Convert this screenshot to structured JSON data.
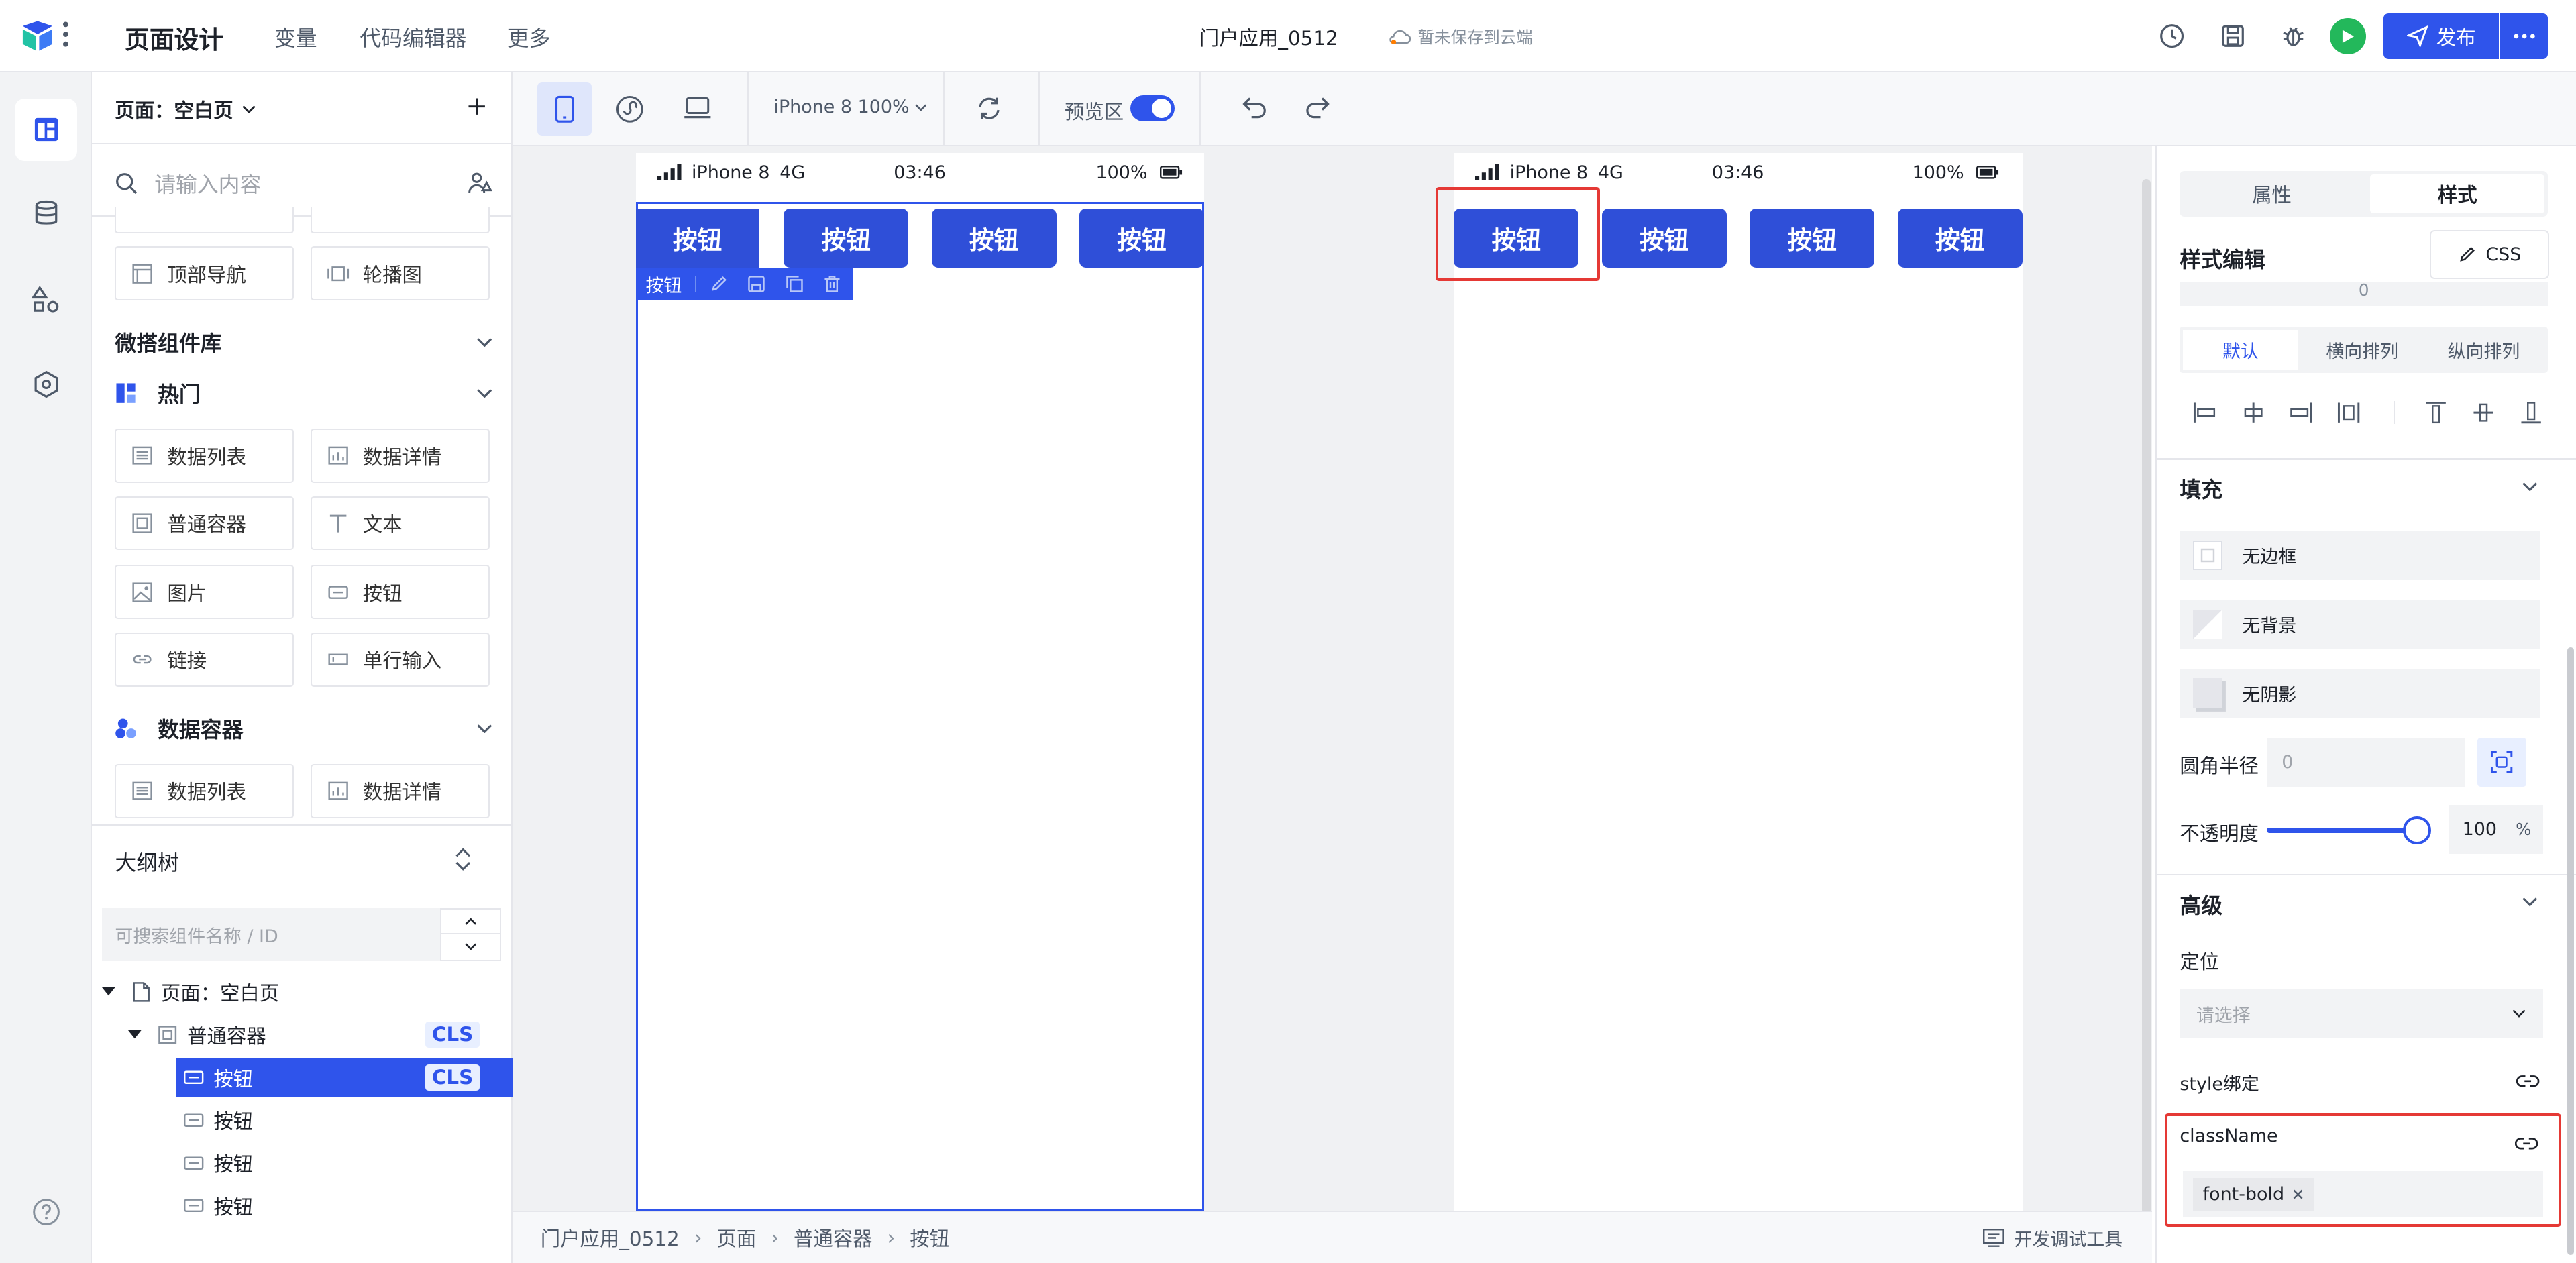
{
  "topbar": {
    "title": "页面设计",
    "menu": [
      "变量",
      "代码编辑器",
      "更多"
    ],
    "app_name": "门户应用_0512",
    "save_status": "暂未保存到云端",
    "publish_label": "发布",
    "brand_color": "#2f54eb"
  },
  "left_panel": {
    "page_selector": "页面：空白页",
    "search_placeholder": "请输入内容",
    "partial_items": [
      "顶部导航",
      "轮播图"
    ],
    "library_title": "微搭组件库",
    "hot_title": "热门",
    "hot_items": [
      "数据列表",
      "数据详情",
      "普通容器",
      "文本",
      "图片",
      "按钮",
      "链接",
      "单行输入"
    ],
    "data_container_title": "数据容器",
    "data_container_items": [
      "数据列表",
      "数据详情"
    ],
    "outline_title": "大纲树",
    "outline_search_placeholder": "可搜索组件名称 / ID",
    "tree": {
      "page": "页面：空白页",
      "container": "普通容器",
      "container_badge": "CLS",
      "buttons": [
        "按钮",
        "按钮",
        "按钮",
        "按钮"
      ],
      "selected_badge": "CLS"
    }
  },
  "toolbar": {
    "device": "iPhone 8 100%",
    "preview_label": "预览区"
  },
  "canvas": {
    "status": {
      "carrier": "iPhone 8",
      "network": "4G",
      "time": "03:46",
      "battery": "100%"
    },
    "buttons": [
      "按钮",
      "按钮",
      "按钮",
      "按钮"
    ],
    "selected_label": "按钮",
    "breadcrumb": [
      "门户应用_0512",
      "页面",
      "普通容器",
      "按钮"
    ],
    "dev_tools": "开发调试工具"
  },
  "right_panel": {
    "tabs": [
      "属性",
      "样式"
    ],
    "style_edit_title": "样式编辑",
    "css_button": "CSS",
    "partial_value": "0",
    "layout_tabs": [
      "默认",
      "横向排列",
      "纵向排列"
    ],
    "fill_title": "填充",
    "fill_items": [
      "无边框",
      "无背景",
      "无阴影"
    ],
    "radius_label": "圆角半径",
    "radius_value": "0",
    "opacity_label": "不透明度",
    "opacity_value": "100",
    "opacity_unit": "%",
    "opacity_fraction": 1.0,
    "advanced_title": "高级",
    "position_label": "定位",
    "position_placeholder": "请选择",
    "style_binding_label": "style绑定",
    "classname_label": "className",
    "classname_tag": "font-bold"
  }
}
